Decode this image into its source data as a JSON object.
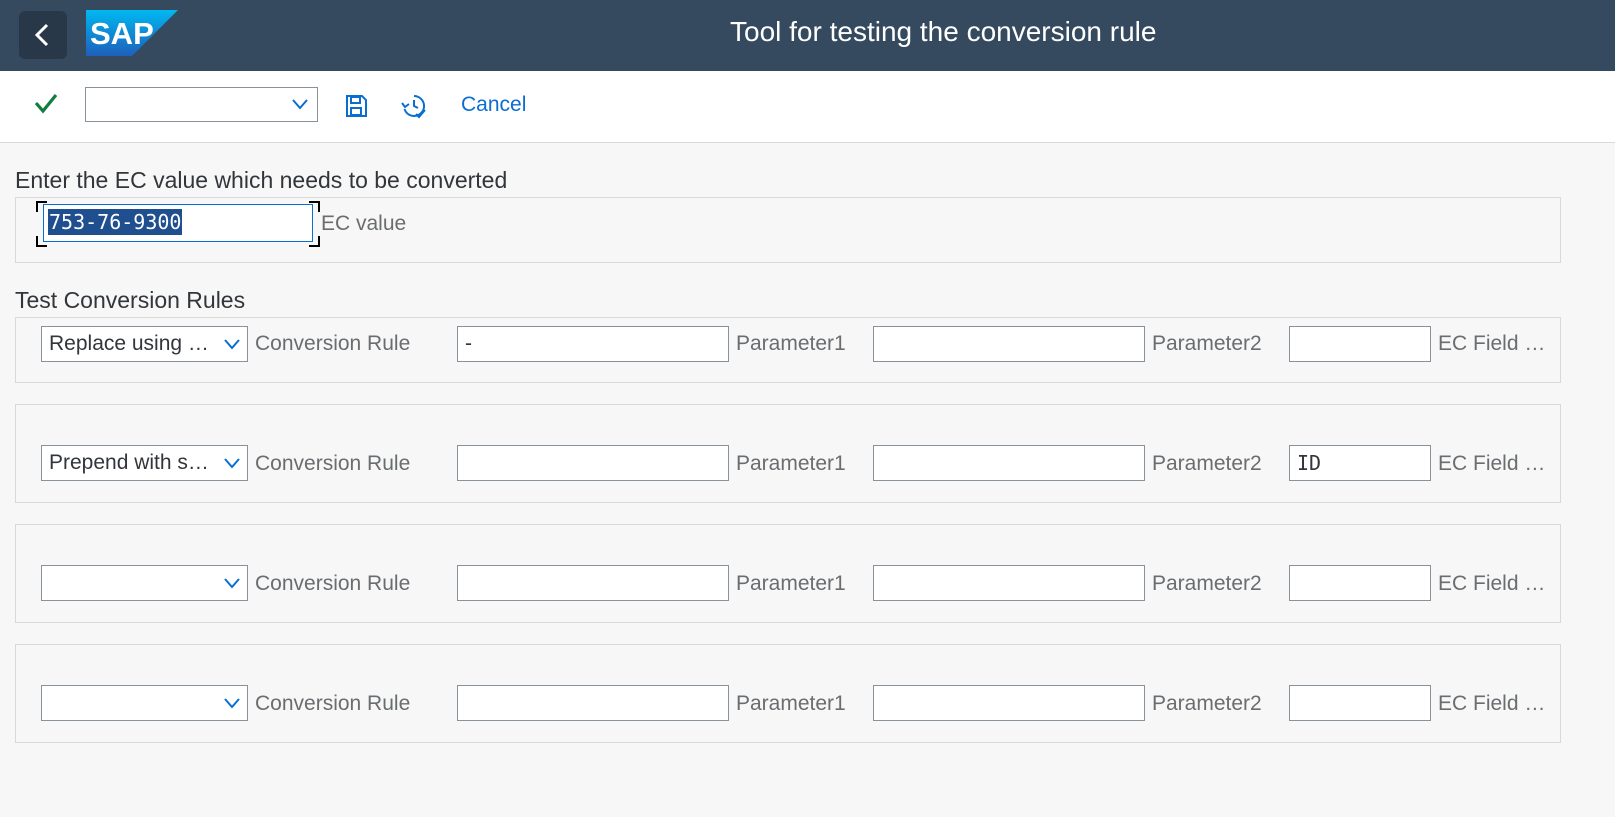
{
  "shell": {
    "title": "Tool for testing the conversion rule",
    "logo_text": "SAP"
  },
  "toolbar": {
    "command_value": "",
    "cancel_label": "Cancel"
  },
  "ec_section": {
    "title": "Enter the EC value which needs to be converted",
    "ec_value": "753-76-9300",
    "ec_value_label": "EC value"
  },
  "rules_section": {
    "title": "Test Conversion Rules",
    "rows": [
      {
        "rule": "Replace using pat…",
        "rule_label": "Conversion Rule",
        "parameter1": "-",
        "parameter1_label": "Parameter1",
        "parameter2": "",
        "parameter2_label": "Parameter2",
        "ec_field": "",
        "ec_field_label": "EC Field …"
      },
      {
        "rule": "Prepend with stri…",
        "rule_label": "Conversion Rule",
        "parameter1": "",
        "parameter1_label": "Parameter1",
        "parameter2": "",
        "parameter2_label": "Parameter2",
        "ec_field": "ID",
        "ec_field_label": "EC Field …"
      },
      {
        "rule": "",
        "rule_label": "Conversion Rule",
        "parameter1": "",
        "parameter1_label": "Parameter1",
        "parameter2": "",
        "parameter2_label": "Parameter2",
        "ec_field": "",
        "ec_field_label": "EC Field …"
      },
      {
        "rule": "",
        "rule_label": "Conversion Rule",
        "parameter1": "",
        "parameter1_label": "Parameter1",
        "parameter2": "",
        "parameter2_label": "Parameter2",
        "ec_field": "",
        "ec_field_label": "EC Field …"
      }
    ]
  },
  "colors": {
    "shell": "#354a5f",
    "accent": "#0a6ed1",
    "check": "#107e3e"
  }
}
